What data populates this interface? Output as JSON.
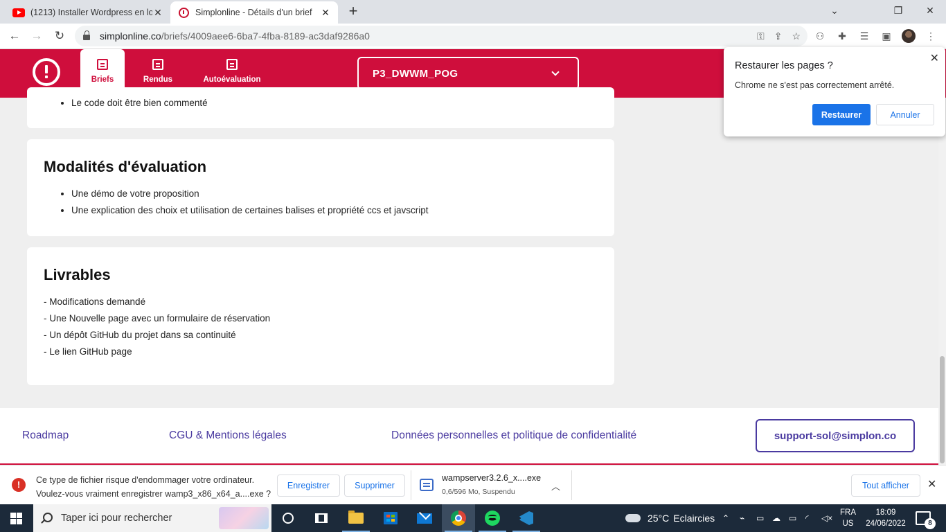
{
  "browser": {
    "tabs": [
      {
        "title": "(1213) Installer Wordpress en loc",
        "favicon": "youtube-icon",
        "close": "✕"
      },
      {
        "title": "Simplonline - Détails d'un brief",
        "favicon": "simplon-icon",
        "close": "✕"
      }
    ],
    "new_tab": "+",
    "window_controls": {
      "minimize": "⌄",
      "restore": "❐",
      "close": "✕"
    },
    "nav": {
      "back": "←",
      "forward": "→",
      "reload": "↻"
    },
    "url": {
      "host": "simplonline.co",
      "path": "/briefs/4009aee6-6ba7-4fba-8189-ac3daf9286a0"
    },
    "url_icons": [
      "key-icon",
      "share-icon",
      "star-icon"
    ],
    "toolbar_icons": [
      "extension-icon",
      "puzzle-icon",
      "reading-list-icon",
      "sidebar-icon",
      "menu-icon"
    ]
  },
  "site": {
    "brand_color": "#cf0e3c",
    "nav": [
      {
        "label": "Briefs",
        "active": true
      },
      {
        "label": "Rendus",
        "active": false
      },
      {
        "label": "Autoévaluation",
        "active": false
      }
    ],
    "promo": "P3_DWWM_POG"
  },
  "content": {
    "prev_card_item": "Le code doit être bien commenté",
    "evaluation": {
      "title": "Modalités d'évaluation",
      "items": [
        "Une démo de votre proposition",
        "Une explication des choix et utilisation de certaines balises et propriété ccs et javscript"
      ]
    },
    "livrables": {
      "title": "Livrables",
      "lines": [
        "- Modifications demandé",
        "- Une Nouvelle page avec un formulaire de réservation",
        "- Un dépôt GitHub du projet dans sa continuité",
        "- Le lien GitHub page"
      ]
    }
  },
  "footer": {
    "links": [
      "Roadmap",
      "CGU & Mentions légales",
      "Données personnelles et politique de confidentialité"
    ],
    "support": "support-sol@simplon.co",
    "link_color": "#4a3aa0"
  },
  "popup": {
    "title": "Restaurer les pages ?",
    "message": "Chrome ne s'est pas correctement arrêté.",
    "restore": "Restaurer",
    "cancel": "Annuler",
    "close": "✕"
  },
  "download_bar": {
    "warning_line1": "Ce type de fichier risque d'endommager votre ordinateur.",
    "warning_line2": "Voulez-vous vraiment enregistrer wamp3_x86_x64_a....exe ?",
    "save": "Enregistrer",
    "delete": "Supprimer",
    "file_name": "wampserver3.2.6_x....exe",
    "file_status": "0,6/596 Mo, Suspendu",
    "show_all": "Tout afficher",
    "close": "✕"
  },
  "taskbar": {
    "search_placeholder": "Taper ici pour rechercher",
    "weather": {
      "temp": "25°C",
      "desc": "Eclaircies"
    },
    "lang": {
      "line1": "FRA",
      "line2": "US"
    },
    "time": "18:09",
    "date": "24/06/2022",
    "notifications": "8",
    "tray_chevron": "⌃"
  }
}
